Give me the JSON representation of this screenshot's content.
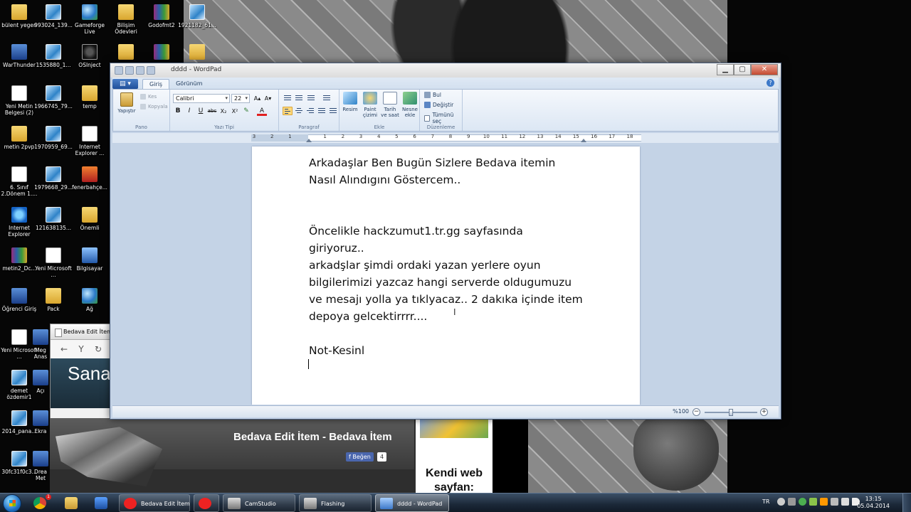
{
  "desktop": {
    "icons": [
      {
        "label": "bülent yegen",
        "icon": "folder-icon"
      },
      {
        "label": "993024_139...",
        "icon": "image-icon"
      },
      {
        "label": "Gameforge Live",
        "icon": "app-icon"
      },
      {
        "label": "Bilişim Ödevleri",
        "icon": "folder-icon"
      },
      {
        "label": "Godofmt2",
        "icon": "archive-icon"
      },
      {
        "label": "1921182_61...",
        "icon": "image-icon"
      },
      {
        "label": "WarThunder",
        "icon": "app-icon"
      },
      {
        "label": "1535880_1...",
        "icon": "image-icon"
      },
      {
        "label": "OSInject",
        "icon": "app-icon"
      },
      {
        "label": "Yeni Metin Belgesi (2)",
        "icon": "document-icon"
      },
      {
        "label": "1966745_79...",
        "icon": "image-icon"
      },
      {
        "label": "temp",
        "icon": "folder-icon"
      },
      {
        "label": "metin 2pvp",
        "icon": "folder-icon"
      },
      {
        "label": "1970959_69...",
        "icon": "image-icon"
      },
      {
        "label": "Internet Explorer ...",
        "icon": "shortcut-icon"
      },
      {
        "label": "6. Sınıf 2.Dönem 1....",
        "icon": "shortcut-icon"
      },
      {
        "label": "1979668_29...",
        "icon": "image-icon"
      },
      {
        "label": "fenerbahçe...",
        "icon": "image-icon"
      },
      {
        "label": "Internet Explorer",
        "icon": "ie-icon"
      },
      {
        "label": "121638135...",
        "icon": "image-icon"
      },
      {
        "label": "Önemli",
        "icon": "folder-icon"
      },
      {
        "label": "metin2_Dc...",
        "icon": "archive-icon"
      },
      {
        "label": "Yeni Microsoft ...",
        "icon": "word-icon"
      },
      {
        "label": "Bilgisayar",
        "icon": "computer-icon"
      },
      {
        "label": "Öğrenci Giriş",
        "icon": "app-icon"
      },
      {
        "label": "Pack",
        "icon": "folder-icon"
      },
      {
        "label": "Ağ",
        "icon": "network-icon"
      },
      {
        "label": "Yeni Microsoft ...",
        "icon": "word-icon"
      },
      {
        "label": "Meg Anas",
        "icon": "app-icon"
      },
      {
        "label": "demet özdemir1",
        "icon": "image-icon"
      },
      {
        "label": "Açı",
        "icon": "app-icon"
      },
      {
        "label": "2014_pana...",
        "icon": "image-icon"
      },
      {
        "label": "Ekra",
        "icon": "app-icon"
      },
      {
        "label": "30fc31f0c3...",
        "icon": "image-icon"
      },
      {
        "label": "Drea Met",
        "icon": "app-icon"
      }
    ]
  },
  "browser": {
    "tab_title": "Bedava Edit İtem",
    "back": "←",
    "refresh": "↻",
    "logo": "Y",
    "banner_text": "Sana"
  },
  "webpage": {
    "header_title": "Bedava Edit İtem - Bedava İtem",
    "like_label": "Beğen",
    "like_count": "4",
    "side_text": "Kendi web sayfan:"
  },
  "wordpad": {
    "title": "dddd - WordPad",
    "window_controls": {
      "minimize": "▁",
      "maximize": "▢",
      "close": "✕"
    },
    "app_menu": "▤ ▾",
    "tabs": [
      {
        "label": "Giriş",
        "active": true
      },
      {
        "label": "Görünüm",
        "active": false
      }
    ],
    "help": "?",
    "ribbon": {
      "clipboard": {
        "paste": "Yapıştır",
        "cut": "Kes",
        "copy": "Kopyala",
        "group": "Pano"
      },
      "font": {
        "family": "Calibri",
        "size": "22",
        "grow": "A▴",
        "shrink": "A▾",
        "bold": "B",
        "italic": "I",
        "underline": "U",
        "strike": "abc",
        "subscript": "X₂",
        "superscript": "X²",
        "highlight": "✎",
        "color": "A",
        "group": "Yazı Tipi"
      },
      "paragraph": {
        "group": "Paragraf"
      },
      "insert": {
        "picture": "Resim",
        "paint": "Paint çizimi",
        "datetime": "Tarih ve saat",
        "object": "Nesne ekle",
        "group": "Ekle"
      },
      "editing": {
        "find": "Bul",
        "replace": "Değiştir",
        "select_all": "Tümünü seç",
        "group": "Düzenleme"
      }
    },
    "ruler_marks": [
      "3",
      "2",
      "1",
      "1",
      "2",
      "3",
      "4",
      "5",
      "6",
      "7",
      "8",
      "9",
      "10",
      "11",
      "12",
      "13",
      "14",
      "15",
      "16",
      "17",
      "18"
    ],
    "document_text": "Arkadaşlar Ben Bugün Sizlere Bedava itemin\nNasıl Alındıgını Göstercem..\n\n\nÖncelikle hackzumut1.tr.gg sayfasında\ngiriyoruz..\narkadşlar şimdi ordaki yazan yerlere oyun\nbilgilerimizi yazcaz hangi serverde oldugumuzu\nve mesajı yolla ya tıklyacaz.. 2 dakıka içinde item\ndepoya gelcektirrrr....\n\nNot-Kesinl",
    "ibeam": "I",
    "zoom": {
      "label": "%100",
      "minus": "−",
      "plus": "+",
      "value_fraction": 0.5
    }
  },
  "taskbar": {
    "pinned": [
      {
        "icon": "chrome-icon",
        "badge": "1"
      },
      {
        "icon": "explorer-icon"
      },
      {
        "icon": "media-player-icon"
      }
    ],
    "tasks": [
      {
        "label": "Bedava Edit İtem ...",
        "icon": "yandex-icon"
      },
      {
        "label": "",
        "icon": "yandex-icon"
      },
      {
        "label": "CamStudio",
        "icon": "camstudio-icon"
      },
      {
        "label": "Flashing",
        "icon": "camstudio-icon"
      },
      {
        "label": "dddd - WordPad",
        "icon": "wordpad-icon",
        "active": true
      }
    ],
    "language": "TR",
    "time": "13:15",
    "date": "05.04.2014"
  }
}
